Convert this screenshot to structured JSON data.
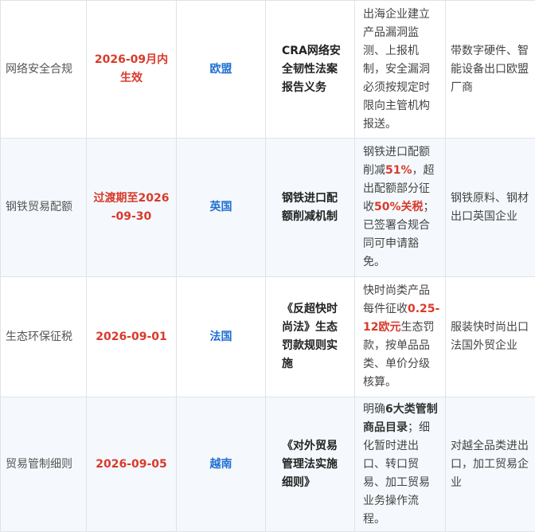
{
  "rows": [
    {
      "category": "网络安全合规",
      "effective": "2026-09月内生效",
      "region": "欧盟",
      "regulation": "CRA网络安全韧性法案报告义务",
      "desc": [
        {
          "t": "出海企业建立产品漏洞监测、上报机制，安全漏洞必须按规定时限向主管机构报送。",
          "s": ""
        }
      ],
      "affected": "带数字硬件、智能设备出口欧盟厂商"
    },
    {
      "category": "钢铁贸易配额",
      "effective": "过渡期至2026-09-30",
      "region": "英国",
      "regulation": "钢铁进口配额削减机制",
      "desc": [
        {
          "t": "钢铁进口配额削减",
          "s": ""
        },
        {
          "t": "51%",
          "s": "hl"
        },
        {
          "t": "，超出配额部分征收",
          "s": ""
        },
        {
          "t": "50%关税",
          "s": "hl"
        },
        {
          "t": "；已签署合规合同可申请豁免。",
          "s": ""
        }
      ],
      "affected": "钢铁原料、钢材出口英国企业"
    },
    {
      "category": "生态环保征税",
      "effective": "2026-09-01",
      "region": "法国",
      "regulation": "《反超快时尚法》生态罚款规则实施",
      "desc": [
        {
          "t": "快时尚类产品每件征收",
          "s": ""
        },
        {
          "t": "0.25-12欧元",
          "s": "hl"
        },
        {
          "t": "生态罚款，按单品品类、单价分级核算。",
          "s": ""
        }
      ],
      "affected": "服装快时尚出口法国外贸企业"
    },
    {
      "category": "贸易管制细则",
      "effective": "2026-09-05",
      "region": "越南",
      "regulation": "《对外贸易管理法实施细则》",
      "desc": [
        {
          "t": "明确",
          "s": ""
        },
        {
          "t": "6大类管制商品目录",
          "s": "em"
        },
        {
          "t": "；细化暂时进出口、转口贸易、加工贸易业务操作流程。",
          "s": ""
        }
      ],
      "affected": "对越全品类进出口，加工贸易企业"
    }
  ]
}
